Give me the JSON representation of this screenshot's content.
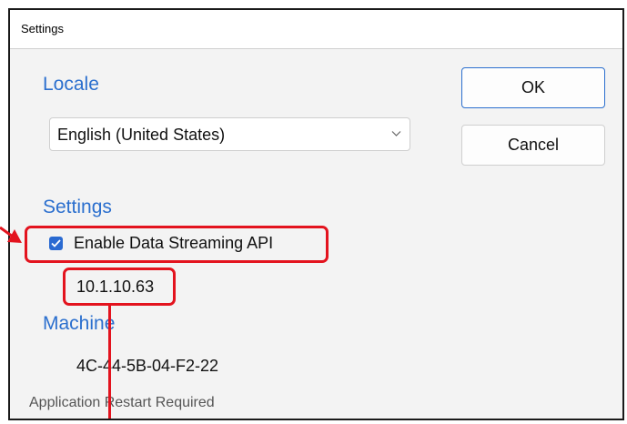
{
  "window": {
    "title": "Settings"
  },
  "locale": {
    "heading": "Locale",
    "dropdown_value": "English (United States)"
  },
  "buttons": {
    "ok": "OK",
    "cancel": "Cancel"
  },
  "settings": {
    "heading": "Settings",
    "enable_label": "Enable Data Streaming API",
    "enable_checked": true,
    "ip_address": "10.1.10.63"
  },
  "machine": {
    "heading": "Machine",
    "mac_address": "4C-44-5B-04-F2-22"
  },
  "footer": {
    "status": "Application Restart Required"
  },
  "colors": {
    "accent": "#2b6fce",
    "highlight": "#e3131e",
    "checkbox": "#2a6ad1"
  },
  "icons": {
    "dropdown": "chevron-down-icon",
    "check": "checkmark-icon",
    "pointer": "arrow-right-icon"
  }
}
